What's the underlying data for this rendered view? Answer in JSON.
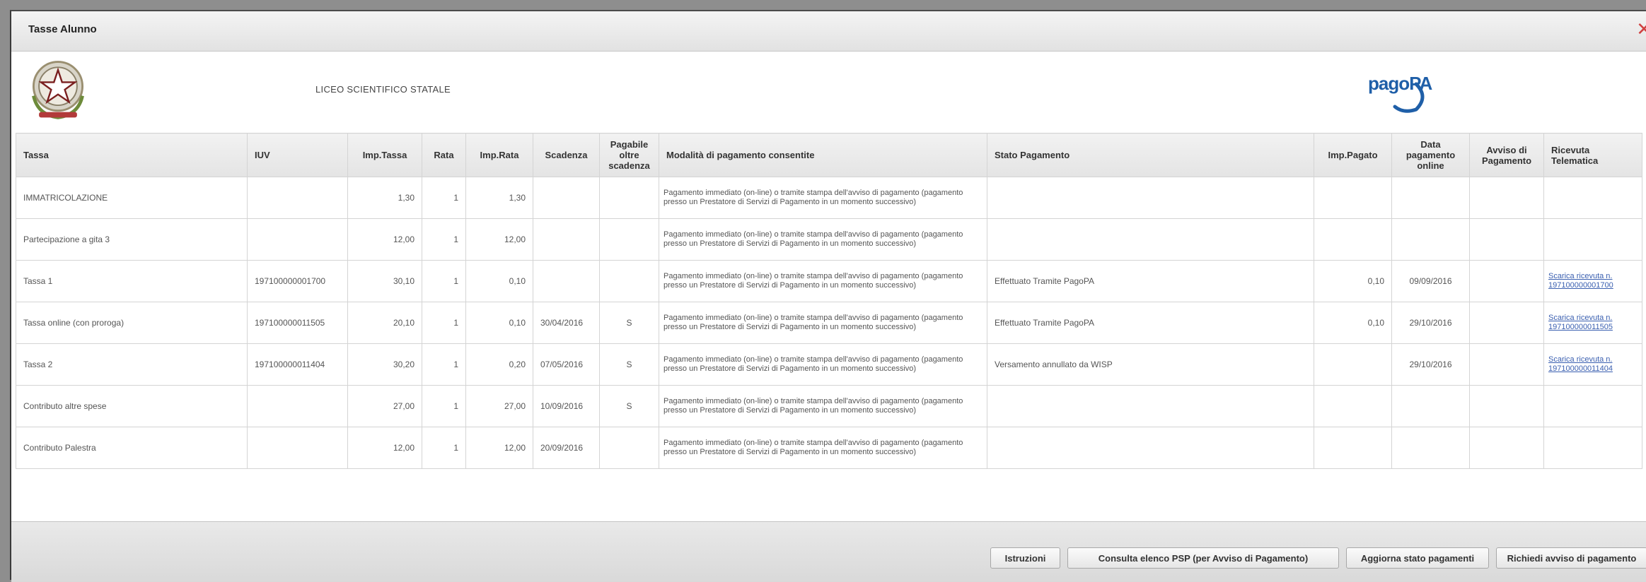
{
  "window": {
    "title": "Tasse Alunno"
  },
  "header": {
    "school_name": "LICEO SCIENTIFICO STATALE",
    "logo_text": "pagoPA"
  },
  "table": {
    "columns": [
      "Tassa",
      "IUV",
      "Imp.Tassa",
      "Rata",
      "Imp.Rata",
      "Scadenza",
      "Pagabile oltre scadenza",
      "Modalità di pagamento consentite",
      "Stato Pagamento",
      "Imp.Pagato",
      "Data pagamento online",
      "Avviso di Pagamento",
      "Ricevuta Telematica"
    ],
    "rows": [
      {
        "tassa": "IMMATRICOLAZIONE",
        "iuv": "",
        "imp_tassa": "1,30",
        "rata": "1",
        "imp_rata": "1,30",
        "scadenza": "",
        "oltre": "",
        "modalita": "Pagamento immediato (on-line) o tramite stampa dell'avviso di pagamento (pagamento presso un Prestatore di Servizi di Pagamento in un momento successivo)",
        "stato": "",
        "imp_pagato": "",
        "data_pag": "",
        "avviso": "",
        "ricevuta": ""
      },
      {
        "tassa": "Partecipazione a gita 3",
        "iuv": "",
        "imp_tassa": "12,00",
        "rata": "1",
        "imp_rata": "12,00",
        "scadenza": "",
        "oltre": "",
        "modalita": "Pagamento immediato (on-line) o tramite stampa dell'avviso di pagamento (pagamento presso un Prestatore di Servizi di Pagamento in un momento successivo)",
        "stato": "",
        "imp_pagato": "",
        "data_pag": "",
        "avviso": "",
        "ricevuta": ""
      },
      {
        "tassa": "Tassa 1",
        "iuv": "197100000001700",
        "imp_tassa": "30,10",
        "rata": "1",
        "imp_rata": "0,10",
        "scadenza": "",
        "oltre": "",
        "modalita": "Pagamento immediato (on-line) o tramite stampa dell'avviso di pagamento (pagamento presso un Prestatore di Servizi di Pagamento in un momento successivo)",
        "stato": "Effettuato Tramite PagoPA",
        "imp_pagato": "0,10",
        "data_pag": "09/09/2016",
        "avviso": "",
        "ricevuta": "Scarica ricevuta n. 197100000001700"
      },
      {
        "tassa": "Tassa online (con proroga)",
        "iuv": "197100000011505",
        "imp_tassa": "20,10",
        "rata": "1",
        "imp_rata": "0,10",
        "scadenza": "30/04/2016",
        "oltre": "S",
        "modalita": "Pagamento immediato (on-line) o tramite stampa dell'avviso di pagamento (pagamento presso un Prestatore di Servizi di Pagamento in un momento successivo)",
        "stato": "Effettuato Tramite PagoPA",
        "imp_pagato": "0,10",
        "data_pag": "29/10/2016",
        "avviso": "",
        "ricevuta": "Scarica ricevuta n. 197100000011505"
      },
      {
        "tassa": "Tassa 2",
        "iuv": "197100000011404",
        "imp_tassa": "30,20",
        "rata": "1",
        "imp_rata": "0,20",
        "scadenza": "07/05/2016",
        "oltre": "S",
        "modalita": "Pagamento immediato (on-line) o tramite stampa dell'avviso di pagamento (pagamento presso un Prestatore di Servizi di Pagamento in un momento successivo)",
        "stato": "Versamento annullato da WISP",
        "imp_pagato": "",
        "data_pag": "29/10/2016",
        "avviso": "",
        "ricevuta": "Scarica ricevuta n. 197100000011404"
      },
      {
        "tassa": "Contributo altre spese",
        "iuv": "",
        "imp_tassa": "27,00",
        "rata": "1",
        "imp_rata": "27,00",
        "scadenza": "10/09/2016",
        "oltre": "S",
        "modalita": "Pagamento immediato (on-line) o tramite stampa dell'avviso di pagamento (pagamento presso un Prestatore di Servizi di Pagamento in un momento successivo)",
        "stato": "",
        "imp_pagato": "",
        "data_pag": "",
        "avviso": "",
        "ricevuta": ""
      },
      {
        "tassa": "Contributo Palestra",
        "iuv": "",
        "imp_tassa": "12,00",
        "rata": "1",
        "imp_rata": "12,00",
        "scadenza": "20/09/2016",
        "oltre": "",
        "modalita": "Pagamento immediato (on-line) o tramite stampa dell'avviso di pagamento (pagamento presso un Prestatore di Servizi di Pagamento in un momento successivo)",
        "stato": "",
        "imp_pagato": "",
        "data_pag": "",
        "avviso": "",
        "ricevuta": ""
      }
    ]
  },
  "footer": {
    "buttons": [
      "Istruzioni",
      "Consulta elenco PSP (per Avviso di Pagamento)",
      "Aggiorna stato pagamenti",
      "Richiedi avviso di pagamento"
    ]
  },
  "colors": {
    "pagopa_blue": "#1f5fa8",
    "close_red": "#d04040",
    "link_blue": "#3a5fb0"
  }
}
